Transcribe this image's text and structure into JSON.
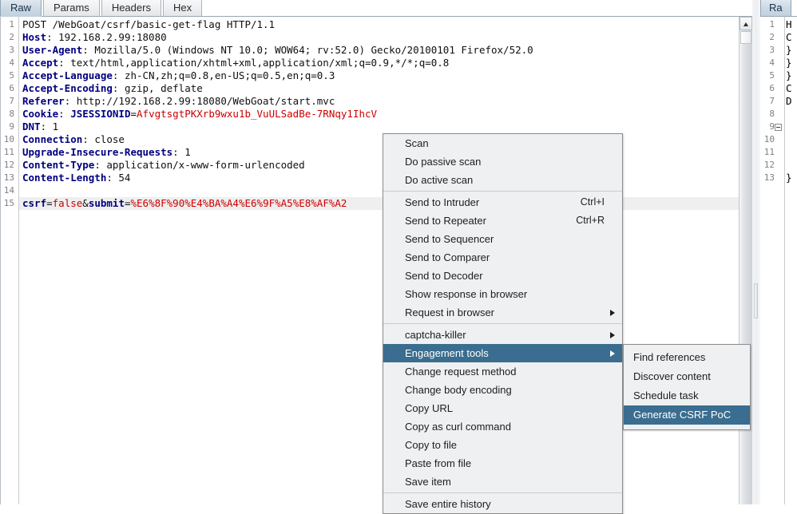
{
  "tabs": {
    "items": [
      {
        "label": "Raw",
        "selected": true
      },
      {
        "label": "Params",
        "selected": false
      },
      {
        "label": "Headers",
        "selected": false
      },
      {
        "label": "Hex",
        "selected": false
      }
    ]
  },
  "request_editor": {
    "lines": [
      {
        "n": 1,
        "parts": [
          {
            "t": "POST /WebGoat/csrf/basic-get-flag HTTP/1.1",
            "c": "black"
          }
        ]
      },
      {
        "n": 2,
        "parts": [
          {
            "t": "Host",
            "c": "blue"
          },
          {
            "t": ": 192.168.2.99:18080",
            "c": "black"
          }
        ]
      },
      {
        "n": 3,
        "parts": [
          {
            "t": "User-Agent",
            "c": "blue"
          },
          {
            "t": ": Mozilla/5.0 (Windows NT 10.0; WOW64; rv:52.0) Gecko/20100101 Firefox/52.0",
            "c": "black"
          }
        ]
      },
      {
        "n": 4,
        "parts": [
          {
            "t": "Accept",
            "c": "blue"
          },
          {
            "t": ": text/html,application/xhtml+xml,application/xml;q=0.9,*/*;q=0.8",
            "c": "black"
          }
        ]
      },
      {
        "n": 5,
        "parts": [
          {
            "t": "Accept-Language",
            "c": "blue"
          },
          {
            "t": ": zh-CN,zh;q=0.8,en-US;q=0.5,en;q=0.3",
            "c": "black"
          }
        ]
      },
      {
        "n": 6,
        "parts": [
          {
            "t": "Accept-Encoding",
            "c": "blue"
          },
          {
            "t": ": gzip, deflate",
            "c": "black"
          }
        ]
      },
      {
        "n": 7,
        "parts": [
          {
            "t": "Referer",
            "c": "blue"
          },
          {
            "t": ": http://192.168.2.99:18080/WebGoat/start.mvc",
            "c": "black"
          }
        ]
      },
      {
        "n": 8,
        "parts": [
          {
            "t": "Cookie",
            "c": "blue"
          },
          {
            "t": ": ",
            "c": "black"
          },
          {
            "t": "JSESSIONID",
            "c": "blue"
          },
          {
            "t": "=",
            "c": "black"
          },
          {
            "t": "AfvgtsgtPKXrb9wxu1b_VuULSadBe-7RNqy1IhcV",
            "c": "red"
          }
        ]
      },
      {
        "n": 9,
        "parts": [
          {
            "t": "DNT",
            "c": "blue"
          },
          {
            "t": ": 1",
            "c": "black"
          }
        ]
      },
      {
        "n": 10,
        "parts": [
          {
            "t": "Connection",
            "c": "blue"
          },
          {
            "t": ": close",
            "c": "black"
          }
        ]
      },
      {
        "n": 11,
        "parts": [
          {
            "t": "Upgrade-Insecure-Requests",
            "c": "blue"
          },
          {
            "t": ": 1",
            "c": "black"
          }
        ]
      },
      {
        "n": 12,
        "parts": [
          {
            "t": "Content-Type",
            "c": "blue"
          },
          {
            "t": ": application/x-www-form-urlencoded",
            "c": "black"
          }
        ]
      },
      {
        "n": 13,
        "parts": [
          {
            "t": "Content-Length",
            "c": "blue"
          },
          {
            "t": ": 54",
            "c": "black"
          }
        ]
      },
      {
        "n": 14,
        "parts": []
      },
      {
        "n": 15,
        "highlight": true,
        "parts": [
          {
            "t": "csrf",
            "c": "blue"
          },
          {
            "t": "=",
            "c": "black"
          },
          {
            "t": "false",
            "c": "red"
          },
          {
            "t": "&",
            "c": "black"
          },
          {
            "t": "submit",
            "c": "blue"
          },
          {
            "t": "=",
            "c": "black"
          },
          {
            "t": "%E6%8F%90%E4%BA%A4%E6%9F%A5%E8%AF%A2",
            "c": "red"
          }
        ]
      }
    ]
  },
  "scrollbar": {
    "up_arrow_icon": "triangle-up-icon",
    "thumb_label": "vertical-scroll-thumb"
  },
  "divider": {
    "grip_label": "split-pane-grip"
  },
  "right_pane": {
    "tab_label": "Ra",
    "lines": [
      {
        "n": 1,
        "text": "H",
        "fold": false
      },
      {
        "n": 2,
        "text": "C",
        "fold": false
      },
      {
        "n": 3,
        "text": "}",
        "fold": false
      },
      {
        "n": 4,
        "text": "}",
        "fold": false
      },
      {
        "n": 5,
        "text": "}",
        "fold": false
      },
      {
        "n": 6,
        "text": "C",
        "fold": false
      },
      {
        "n": 7,
        "text": "D",
        "fold": false
      },
      {
        "n": 8,
        "text": "",
        "fold": false
      },
      {
        "n": 9,
        "text": "",
        "fold": true
      },
      {
        "n": 10,
        "text": "",
        "fold": false
      },
      {
        "n": 11,
        "text": "",
        "fold": false
      },
      {
        "n": 12,
        "text": "",
        "fold": false
      },
      {
        "n": 13,
        "text": "}",
        "fold": false
      }
    ]
  },
  "context_menu": {
    "items": [
      {
        "label": "Scan",
        "accel": "",
        "submenu": false,
        "selected": false,
        "separator_after": false
      },
      {
        "label": "Do passive scan",
        "accel": "",
        "submenu": false,
        "selected": false,
        "separator_after": false
      },
      {
        "label": "Do active scan",
        "accel": "",
        "submenu": false,
        "selected": false,
        "separator_after": true
      },
      {
        "label": "Send to Intruder",
        "accel": "Ctrl+I",
        "submenu": false,
        "selected": false,
        "separator_after": false
      },
      {
        "label": "Send to Repeater",
        "accel": "Ctrl+R",
        "submenu": false,
        "selected": false,
        "separator_after": false
      },
      {
        "label": "Send to Sequencer",
        "accel": "",
        "submenu": false,
        "selected": false,
        "separator_after": false
      },
      {
        "label": "Send to Comparer",
        "accel": "",
        "submenu": false,
        "selected": false,
        "separator_after": false
      },
      {
        "label": "Send to Decoder",
        "accel": "",
        "submenu": false,
        "selected": false,
        "separator_after": false
      },
      {
        "label": "Show response in browser",
        "accel": "",
        "submenu": false,
        "selected": false,
        "separator_after": false
      },
      {
        "label": "Request in browser",
        "accel": "",
        "submenu": true,
        "selected": false,
        "separator_after": true
      },
      {
        "label": "captcha-killer",
        "accel": "",
        "submenu": true,
        "selected": false,
        "separator_after": false
      },
      {
        "label": "Engagement tools",
        "accel": "",
        "submenu": true,
        "selected": true,
        "separator_after": false
      },
      {
        "label": "Change request method",
        "accel": "",
        "submenu": false,
        "selected": false,
        "separator_after": false
      },
      {
        "label": "Change body encoding",
        "accel": "",
        "submenu": false,
        "selected": false,
        "separator_after": false
      },
      {
        "label": "Copy URL",
        "accel": "",
        "submenu": false,
        "selected": false,
        "separator_after": false
      },
      {
        "label": "Copy as curl command",
        "accel": "",
        "submenu": false,
        "selected": false,
        "separator_after": false
      },
      {
        "label": "Copy to file",
        "accel": "",
        "submenu": false,
        "selected": false,
        "separator_after": false
      },
      {
        "label": "Paste from file",
        "accel": "",
        "submenu": false,
        "selected": false,
        "separator_after": false
      },
      {
        "label": "Save item",
        "accel": "",
        "submenu": false,
        "selected": false,
        "separator_after": true
      },
      {
        "label": "Save entire history",
        "accel": "",
        "submenu": false,
        "selected": false,
        "separator_after": false
      }
    ]
  },
  "engagement_submenu": {
    "items": [
      {
        "label": "Find references",
        "selected": false
      },
      {
        "label": "Discover content",
        "selected": false
      },
      {
        "label": "Schedule task",
        "selected": false
      },
      {
        "label": "Generate CSRF PoC",
        "selected": true
      }
    ]
  },
  "colors": {
    "menu_bg": "#eef0f2",
    "menu_border": "#8b8b8b",
    "highlight": "#3a6d8f",
    "header_name": "#000080",
    "header_value": "#cc0000",
    "line_number": "#808080",
    "selected_line_bg": "#efefef"
  }
}
